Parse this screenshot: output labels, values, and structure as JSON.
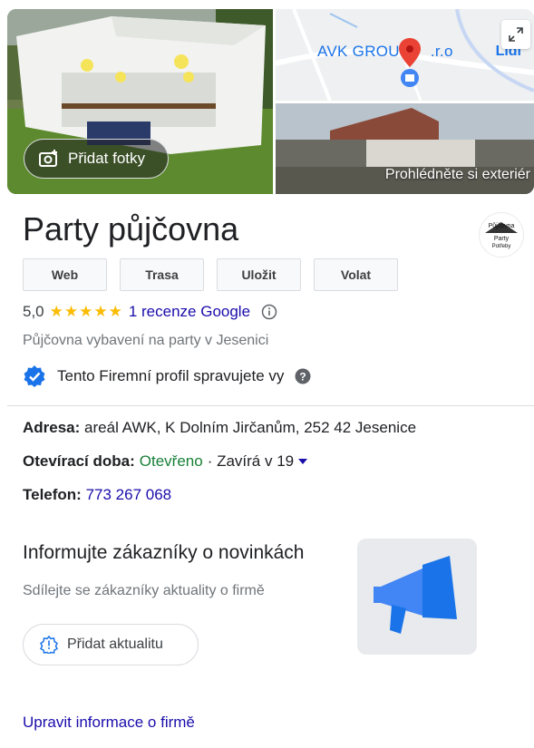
{
  "photos": {
    "add_photos_label": "Přidat fotky",
    "map_label": "AVK GROU",
    "map_label_suffix": ".r.o",
    "map_poi": "Lidl",
    "exterior_label": "Prohlédněte si exteriér"
  },
  "business": {
    "name": "Party půjčovna",
    "logo_text": [
      "Půjčovna",
      "Party",
      "Potřeby"
    ],
    "actions": [
      "Web",
      "Trasa",
      "Uložit",
      "Volat"
    ],
    "rating": "5,0",
    "stars": "★★★★★",
    "reviews_link": "1 recenze Google",
    "category": "Půjčovna vybavení na party v Jesenici",
    "verified_text": "Tento Firemní profil spravujete vy"
  },
  "details": {
    "address_label": "Adresa:",
    "address_value": "areál AWK, K Dolním Jirčanům, 252 42 Jesenice",
    "hours_label": "Otevírací doba:",
    "hours_status": "Otevřeno",
    "hours_close": "· Zavírá v 19",
    "phone_label": "Telefon:",
    "phone_value": "773 267 068"
  },
  "promo": {
    "title": "Informujte zákazníky o novinkách",
    "subtitle": "Sdílejte se zákazníky aktuality o firmě",
    "button_label": "Přidat aktualitu"
  },
  "footer": {
    "edit_link": "Upravit informace o firmě"
  },
  "colors": {
    "link": "#1a0dab",
    "open": "#188038",
    "star": "#fbbc04",
    "verified": "#1a73e8"
  }
}
